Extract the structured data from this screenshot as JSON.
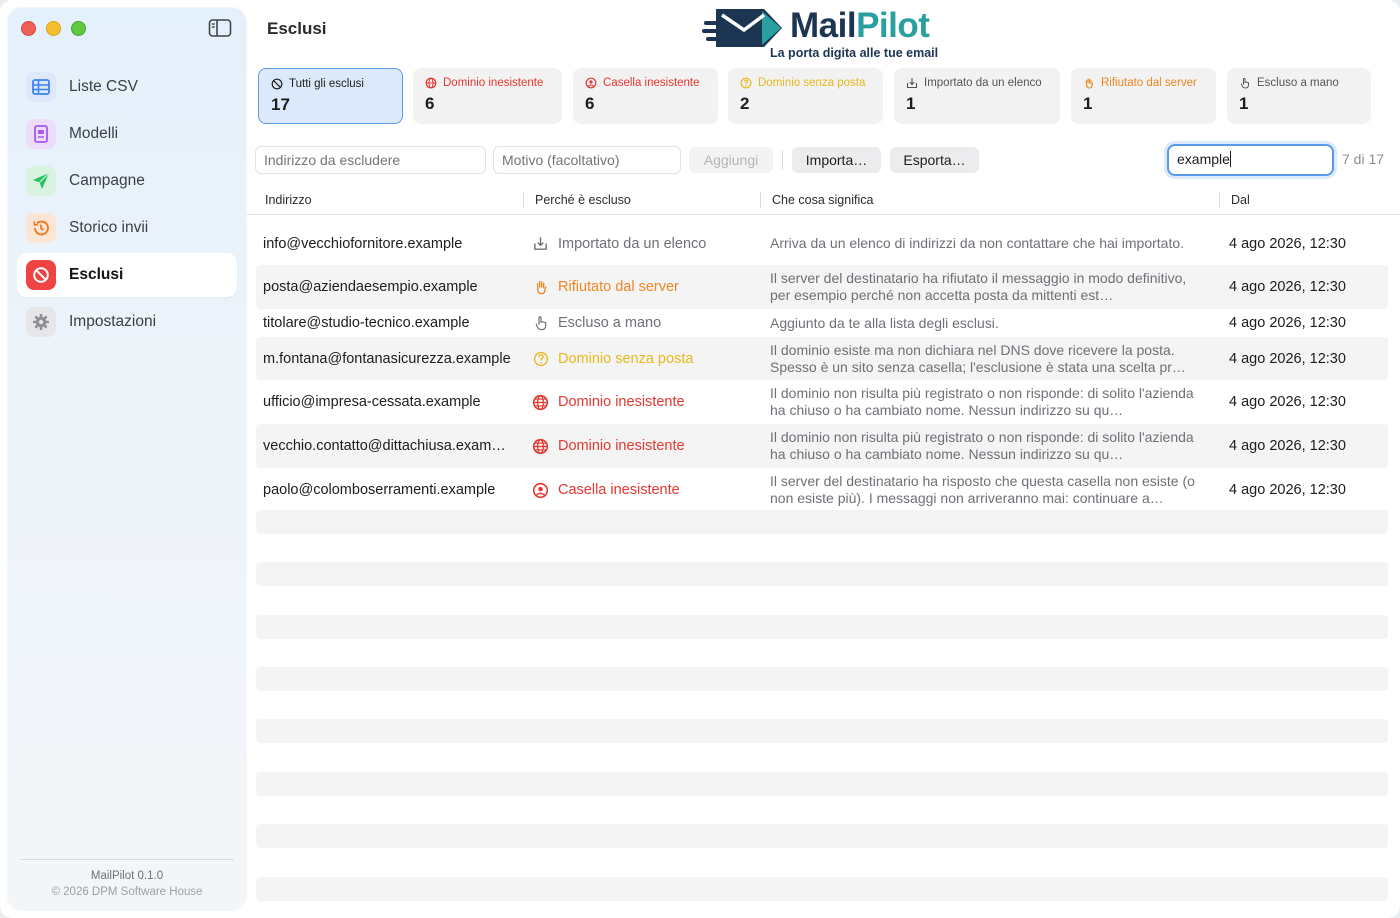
{
  "window": {
    "title": "Esclusi"
  },
  "sidebar": {
    "items": [
      {
        "label": "Liste CSV",
        "icon": "table-icon",
        "color": "#3b82f6"
      },
      {
        "label": "Modelli",
        "icon": "template-icon",
        "color": "#a855f7"
      },
      {
        "label": "Campagne",
        "icon": "paper-plane-icon",
        "color": "#22c55e"
      },
      {
        "label": "Storico invii",
        "icon": "history-icon",
        "color": "#f97316"
      },
      {
        "label": "Esclusi",
        "icon": "prohibited-icon",
        "color": "#ef4444",
        "active": true
      },
      {
        "label": "Impostazioni",
        "icon": "gear-icon",
        "color": "#8e8e93"
      }
    ],
    "footer": {
      "version": "MailPilot 0.1.0",
      "copyright": "© 2026 DPM Software House"
    }
  },
  "logo": {
    "name_part1": "Mail",
    "name_part2": "Pilot",
    "tagline": "La porta digita alle tue email"
  },
  "filters": [
    {
      "label": "Tutti gli esclusi",
      "count": "17",
      "icon": "prohibited-icon",
      "color": "#1d1d1d",
      "selected": true
    },
    {
      "label": "Dominio inesistente",
      "count": "6",
      "icon": "broken-globe-icon",
      "color": "#e5372f"
    },
    {
      "label": "Casella inesistente",
      "count": "6",
      "icon": "person-x-icon",
      "color": "#e5372f"
    },
    {
      "label": "Dominio senza posta",
      "count": "2",
      "icon": "question-circle-icon",
      "color": "#e8b81c"
    },
    {
      "label": "Importato da un elenco",
      "count": "1",
      "icon": "import-tray-icon",
      "color": "#555555"
    },
    {
      "label": "Rifiutato dal server",
      "count": "1",
      "icon": "hand-stop-icon",
      "color": "#f0861f"
    },
    {
      "label": "Escluso a mano",
      "count": "1",
      "icon": "hand-point-icon",
      "color": "#555555"
    }
  ],
  "toolbar": {
    "address_placeholder": "Indirizzo da escludere",
    "reason_placeholder": "Motivo (facoltativo)",
    "add_label": "Aggiungi",
    "import_label": "Importa…",
    "export_label": "Esporta…",
    "search_value": "example",
    "result_count": "7 di 17"
  },
  "table": {
    "columns": [
      "Indirizzo",
      "Perché è escluso",
      "Che cosa significa",
      "Dal"
    ],
    "rows": [
      {
        "address": "info@vecchiofornitore.example",
        "reason": "Importato da un elenco",
        "reason_icon": "import-tray-icon",
        "reason_color": "#6d7076",
        "meaning": "Arriva da un elenco di indirizzi da non contattare che hai importato.",
        "date": "4 ago 2026, 12:30"
      },
      {
        "address": "posta@aziendaesempio.example",
        "reason": "Rifiutato dal server",
        "reason_icon": "hand-stop-icon",
        "reason_color": "#f0861f",
        "meaning": "Il server del destinatario ha rifiutato il messaggio in modo definitivo, per esempio perché non accetta posta da mittenti est…",
        "date": "4 ago 2026, 12:30"
      },
      {
        "address": "titolare@studio-tecnico.example",
        "reason": "Escluso a mano",
        "reason_icon": "hand-point-icon",
        "reason_color": "#6d7076",
        "meaning": "Aggiunto da te alla lista degli esclusi.",
        "date": "4 ago 2026, 12:30"
      },
      {
        "address": "m.fontana@fontanasicurezza.example",
        "reason": "Dominio senza posta",
        "reason_icon": "question-circle-icon",
        "reason_color": "#e8b81c",
        "meaning": "Il dominio esiste ma non dichiara nel DNS dove ricevere la posta. Spesso è un sito senza casella; l'esclusione è stata una scelta pr…",
        "date": "4 ago 2026, 12:30"
      },
      {
        "address": "ufficio@impresa-cessata.example",
        "reason": "Dominio inesistente",
        "reason_icon": "broken-globe-icon",
        "reason_color": "#e5372f",
        "meaning": "Il dominio non risulta più registrato o non risponde: di solito l'azienda ha chiuso o ha cambiato nome. Nessun indirizzo su qu…",
        "date": "4 ago 2026, 12:30"
      },
      {
        "address": "vecchio.contatto@dittachiusa.exam…",
        "reason": "Dominio inesistente",
        "reason_icon": "broken-globe-icon",
        "reason_color": "#e5372f",
        "meaning": "Il dominio non risulta più registrato o non risponde: di solito l'azienda ha chiuso o ha cambiato nome. Nessun indirizzo su qu…",
        "date": "4 ago 2026, 12:30"
      },
      {
        "address": "paolo@colomboserramenti.example",
        "reason": "Casella inesistente",
        "reason_icon": "person-x-icon",
        "reason_color": "#e5372f",
        "meaning": "Il server del destinatario ha risposto che questa casella non esiste (o non esiste più). I messaggi non arriveranno mai: continuare a…",
        "date": "4 ago 2026, 12:30"
      }
    ]
  }
}
